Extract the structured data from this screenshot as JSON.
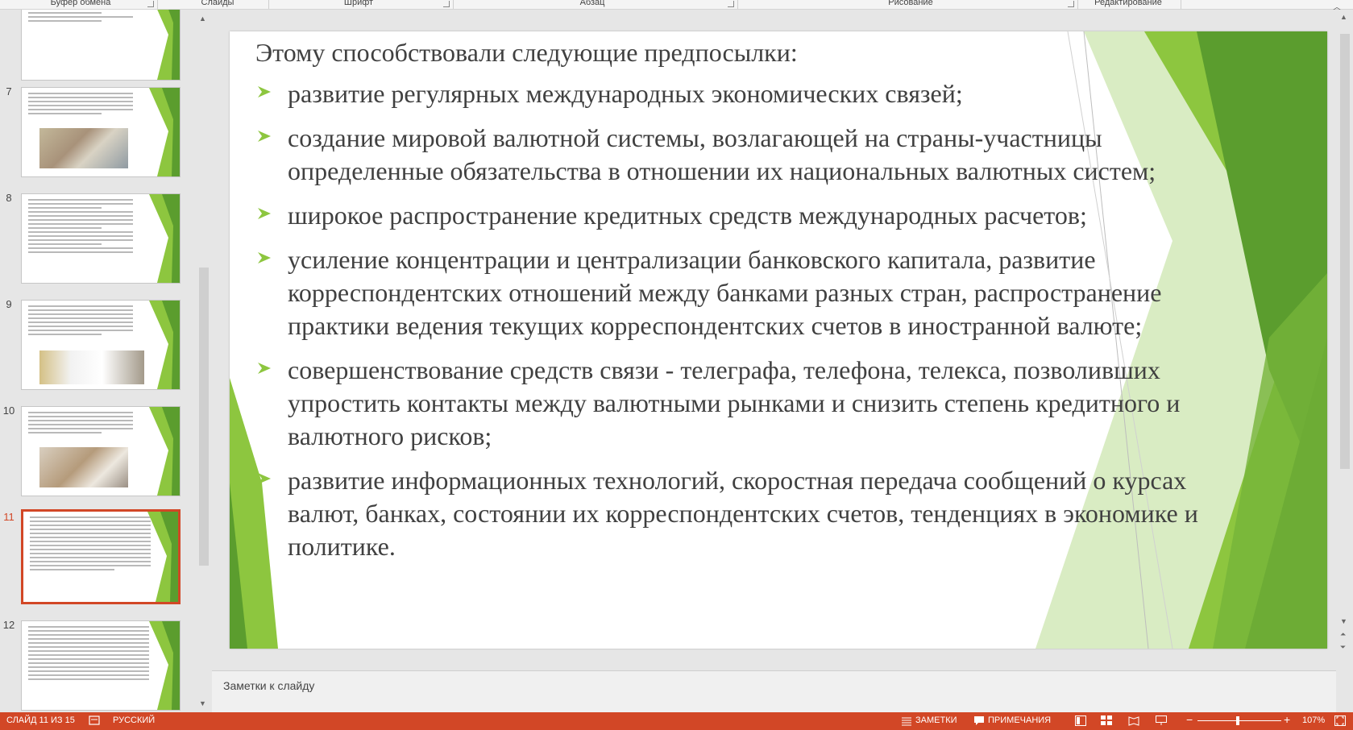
{
  "ribbon": {
    "groups": [
      "Буфер обмена",
      "Слайды",
      "Шрифт",
      "Абзац",
      "Рисование",
      "Редактирование"
    ]
  },
  "thumbnails": [
    {
      "number": "",
      "active": false
    },
    {
      "number": "7",
      "active": false
    },
    {
      "number": "8",
      "active": false
    },
    {
      "number": "9",
      "active": false
    },
    {
      "number": "10",
      "active": false
    },
    {
      "number": "11",
      "active": true
    },
    {
      "number": "12",
      "active": false
    }
  ],
  "slide": {
    "intro": "Этому способствовали следующие предпосылки:",
    "bullets": [
      "развитие регулярных международных экономических связей;",
      "создание мировой валютной системы, возлагающей на страны-участницы определенные обязательства в отношении их национальных валютных систем;",
      "широкое распространение кредитных средств международных расчетов;",
      "усиление концентрации и централизации банковского капитала, развитие корреспондентских отношений между банками разных стран, распространение практики ведения текущих корреспондентских счетов в иностранной валюте;",
      "совершенствование средств связи - телеграфа, телефона, телекса, позволивших упростить контакты между валютными рынками и снизить степень кредитного и валютного рисков;",
      "развитие информационных технологий, скоростная передача сообщений о курсах валют, банках, состоянии их корреспондентских счетов, тенденциях в экономике и политике."
    ]
  },
  "notes": {
    "placeholder": "Заметки к слайду"
  },
  "status": {
    "slide_counter": "СЛАЙД 11 ИЗ 15",
    "language": "РУССКИЙ",
    "notes_btn": "ЗАМЕТКИ",
    "comments_btn": "ПРИМЕЧАНИЯ",
    "zoom": "107%",
    "zoom_level_percent": 107
  },
  "colors": {
    "accent": "#d24726",
    "green_dark": "#5b9d2e",
    "green_light": "#8dc63f",
    "bullet": "#8dc63f"
  }
}
